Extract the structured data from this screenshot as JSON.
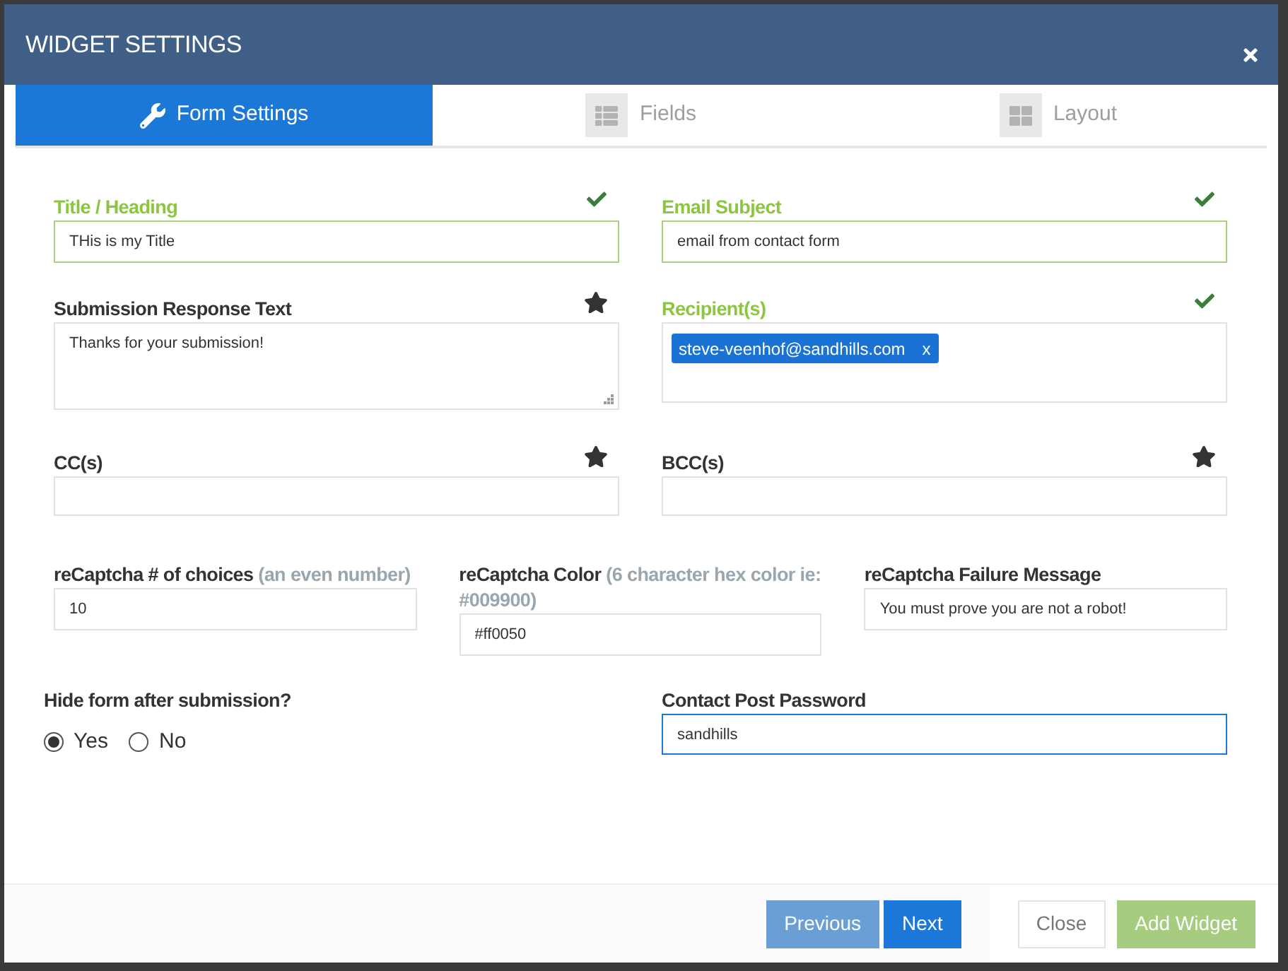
{
  "window": {
    "title": "WIDGET SETTINGS"
  },
  "tabs": [
    {
      "label": "Form Settings",
      "selected": true
    },
    {
      "label": "Fields",
      "selected": false
    },
    {
      "label": "Layout",
      "selected": false
    }
  ],
  "main_fields": [
    {
      "kind": "text",
      "label": "Title / Heading",
      "value": "THis is my Title",
      "valid": true
    },
    {
      "kind": "text",
      "label": "Email Subject",
      "value": "email from contact form",
      "valid": true
    },
    {
      "kind": "textarea",
      "label": "Submission Response Text",
      "value": "Thanks for your submission!",
      "valid": false
    },
    {
      "kind": "tags",
      "label": "Recipient(s)",
      "tags": [
        {
          "text": "steve-veenhof@sandhills.com",
          "remove": "x"
        }
      ],
      "valid": true
    },
    {
      "kind": "text",
      "label": "CC(s)",
      "valid": false
    },
    {
      "kind": "text",
      "label": "BCC(s)",
      "valid": false
    }
  ],
  "captcha_fields": [
    {
      "label": "reCaptcha # of choices",
      "hint": "(an even number)",
      "value": "10"
    },
    {
      "label": "reCaptcha Color",
      "hint": "(6 character hex color ie: #009900)",
      "value": "#ff0050"
    },
    {
      "label": "reCaptcha Failure Message",
      "value": "You must prove you are not a robot!"
    }
  ],
  "hide_form": {
    "label": "Hide form after submission?",
    "options": [
      {
        "label": "Yes",
        "selected": true
      },
      {
        "label": "No",
        "selected": false
      }
    ]
  },
  "password": {
    "label": "Contact Post Password",
    "value": "sandhills",
    "focused": true
  },
  "nav_buttons": [
    {
      "label": "Previous",
      "kind": "secondary"
    },
    {
      "label": "Next",
      "kind": "primary"
    }
  ],
  "action_buttons": [
    {
      "label": "Close",
      "kind": "outline"
    },
    {
      "label": "Add Widget",
      "kind": "success"
    }
  ]
}
